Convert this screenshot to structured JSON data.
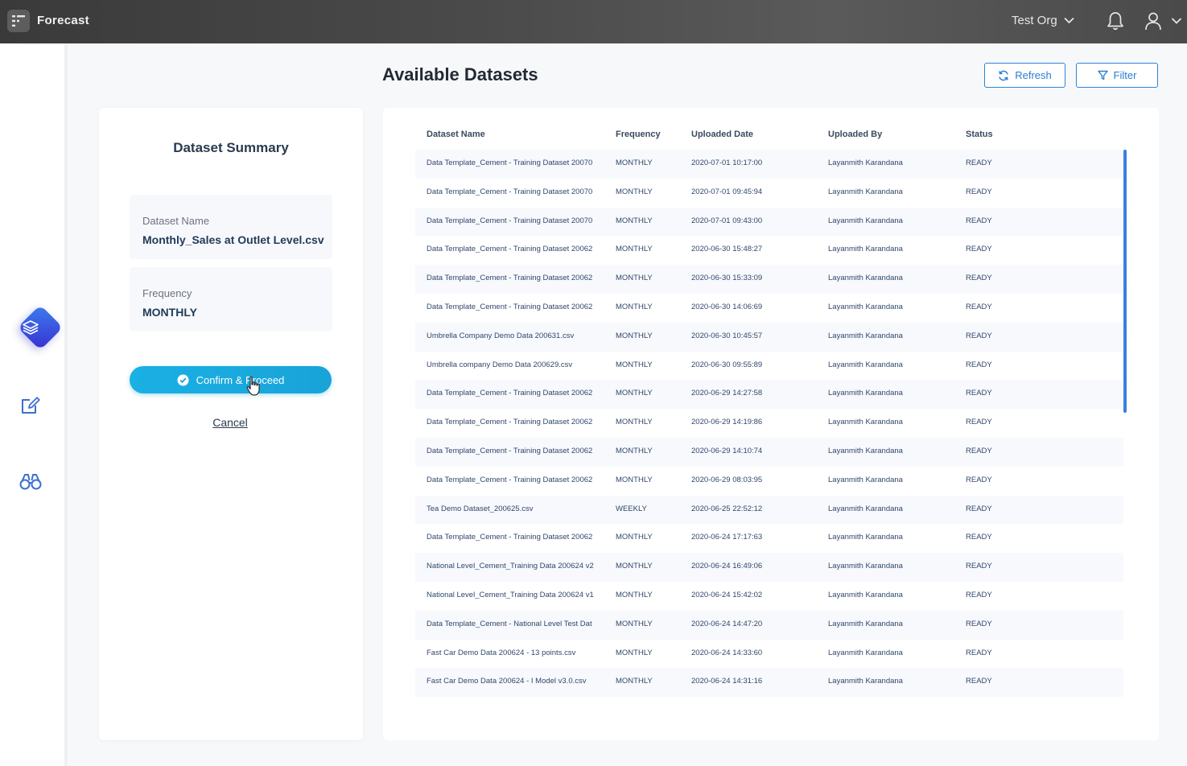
{
  "topbar": {
    "app_title": "Forecast",
    "org_name": "Test Org"
  },
  "rail": {
    "items": [
      "layers-icon",
      "edit-icon",
      "binoculars-icon"
    ]
  },
  "summary": {
    "title": "Dataset Summary",
    "dataset_name_label": "Dataset Name",
    "dataset_name_value": "Monthly_Sales at Outlet Level.csv",
    "frequency_label": "Frequency",
    "frequency_value": "MONTHLY",
    "confirm_label": "Confirm & Proceed",
    "cancel_label": "Cancel"
  },
  "main": {
    "title": "Available Datasets",
    "refresh_label": "Refresh",
    "filter_label": "Filter"
  },
  "table": {
    "columns": [
      "Dataset Name",
      "Frequency",
      "Uploaded Date",
      "Uploaded By",
      "Status"
    ],
    "rows": [
      [
        "Data Template_Cement - Training Dataset 20070",
        "MONTHLY",
        "2020-07-01 10:17:00",
        "Layanmith Karandana",
        "READY"
      ],
      [
        "Data Template_Cement - Training Dataset 20070",
        "MONTHLY",
        "2020-07-01 09:45:94",
        "Layanmith Karandana",
        "READY"
      ],
      [
        "Data Template_Cement - Training Dataset 20070",
        "MONTHLY",
        "2020-07-01 09:43:00",
        "Layanmith Karandana",
        "READY"
      ],
      [
        "Data Template_Cement - Training Dataset 20062",
        "MONTHLY",
        "2020-06-30 15:48:27",
        "Layanmith Karandana",
        "READY"
      ],
      [
        "Data Template_Cement - Training Dataset 20062",
        "MONTHLY",
        "2020-06-30 15:33:09",
        "Layanmith Karandana",
        "READY"
      ],
      [
        "Data Template_Cement - Training Dataset 20062",
        "MONTHLY",
        "2020-06-30 14:06:69",
        "Layanmith Karandana",
        "READY"
      ],
      [
        "Umbrella Company Demo Data 200631.csv",
        "MONTHLY",
        "2020-06-30 10:45:57",
        "Layanmith Karandana",
        "READY"
      ],
      [
        "Umbrella company Demo Data 200629.csv",
        "MONTHLY",
        "2020-06-30 09:55:89",
        "Layanmith Karandana",
        "READY"
      ],
      [
        "Data Template_Cement - Training Dataset 20062",
        "MONTHLY",
        "2020-06-29 14:27:58",
        "Layanmith Karandana",
        "READY"
      ],
      [
        "Data Template_Cement - Training Dataset 20062",
        "MONTHLY",
        "2020-06-29 14:19:86",
        "Layanmith Karandana",
        "READY"
      ],
      [
        "Data Template_Cement - Training Dataset 20062",
        "MONTHLY",
        "2020-06-29 14:10:74",
        "Layanmith Karandana",
        "READY"
      ],
      [
        "Data Template_Cement - Training Dataset 20062",
        "MONTHLY",
        "2020-06-29 08:03:95",
        "Layanmith Karandana",
        "READY"
      ],
      [
        "Tea Demo Dataset_200625.csv",
        "WEEKLY",
        "2020-06-25 22:52:12",
        "Layanmith Karandana",
        "READY"
      ],
      [
        "Data Template_Cement - Training Dataset 20062",
        "MONTHLY",
        "2020-06-24 17:17:63",
        "Layanmith Karandana",
        "READY"
      ],
      [
        "National Level_Cement_Training Data 200624 v2",
        "MONTHLY",
        "2020-06-24 16:49:06",
        "Layanmith Karandana",
        "READY"
      ],
      [
        "National Level_Cement_Training Data 200624 v1",
        "MONTHLY",
        "2020-06-24 15:42:02",
        "Layanmith Karandana",
        "READY"
      ],
      [
        "Data Template_Cement - National Level Test Dat",
        "MONTHLY",
        "2020-06-24 14:47:20",
        "Layanmith Karandana",
        "READY"
      ],
      [
        "Fast Car Demo Data 200624 - 13 points.csv",
        "MONTHLY",
        "2020-06-24 14:33:60",
        "Layanmith Karandana",
        "READY"
      ],
      [
        "Fast Car Demo Data 200624 - I Model v3.0.csv",
        "MONTHLY",
        "2020-06-24 14:31:16",
        "Layanmith Karandana",
        "READY"
      ]
    ]
  },
  "colors": {
    "accent": "#1ab0e4",
    "link_blue": "#2c7ed0",
    "active_rail": "#3a55e0",
    "topbar": "#3f3f3f"
  }
}
